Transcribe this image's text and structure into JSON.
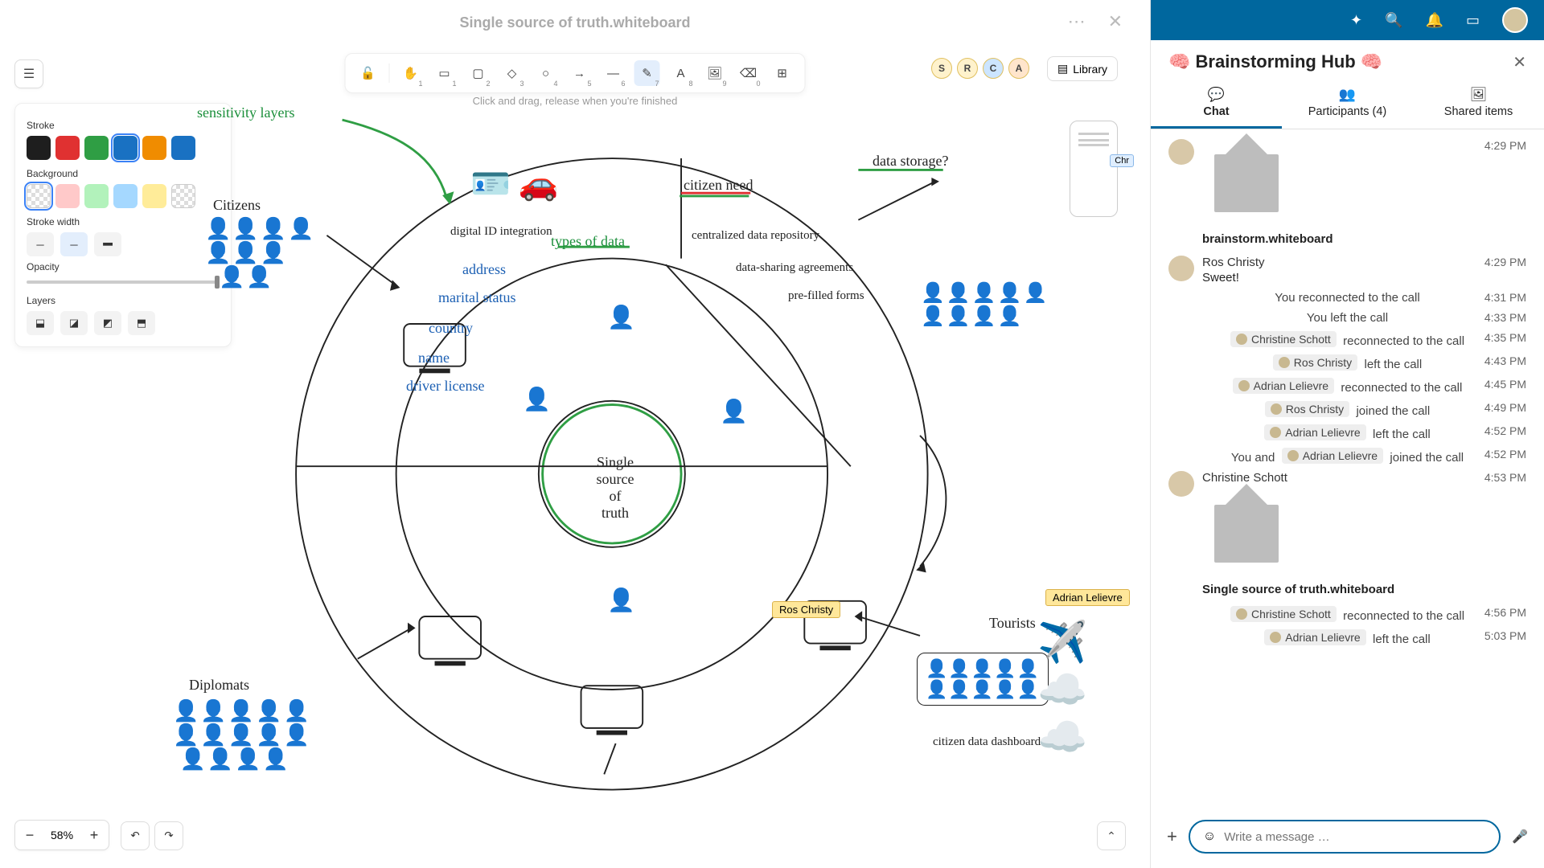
{
  "canvas": {
    "title": "Single source of truth.whiteboard",
    "hint": "Click and drag, release when you're finished",
    "zoom": "58%"
  },
  "style_panel": {
    "stroke_label": "Stroke",
    "bg_label": "Background",
    "width_label": "Stroke width",
    "opacity_label": "Opacity",
    "layers_label": "Layers",
    "stroke_colors": [
      "#1e1e1e",
      "#e03131",
      "#2f9e44",
      "#1971c2",
      "#f08c00",
      "#1971c2"
    ],
    "bg_colors": [
      "transparent",
      "#ffc9c9",
      "#b2f2bb",
      "#a5d8ff",
      "#ffec99",
      "transparent"
    ]
  },
  "toolbar": {
    "library": "Library"
  },
  "participants": [
    "S",
    "R",
    "C",
    "A"
  ],
  "drawing": {
    "center": "Single\nsource\nof\ntruth",
    "citizens": "Citizens",
    "diplomats": "Diplomats",
    "tourists": "Tourists",
    "types": "types of data",
    "address": "address",
    "marital": "marital status",
    "country": "country",
    "name": "name",
    "license": "driver license",
    "sensitivity": "sensitivity layers",
    "digital_id": "digital ID integration",
    "need": "citizen need",
    "storage": "data storage?",
    "repo": "centralized data repository",
    "sharing": "data-sharing agreements",
    "forms": "pre-filled forms",
    "dashboard": "citizen data dashboard",
    "cursor_ros": "Ros Christy",
    "cursor_adrian": "Adrian Lelievre",
    "minimap_cursor": "Chr"
  },
  "chat": {
    "title": "🧠 Brainstorming Hub 🧠",
    "tabs": {
      "chat": "Chat",
      "participants": "Participants (4)",
      "shared": "Shared items"
    },
    "input_placeholder": "Write a message …",
    "items": [
      {
        "type": "wb",
        "time": "4:29 PM",
        "name": "brainstorm.whiteboard"
      },
      {
        "type": "msg",
        "author": "Ros Christy",
        "text": "Sweet!",
        "time": "4:29 PM"
      },
      {
        "type": "sys",
        "text": "You reconnected to the call",
        "time": "4:31 PM"
      },
      {
        "type": "sys",
        "text": "You left the call",
        "time": "4:33 PM"
      },
      {
        "type": "sys_pill",
        "pill": "Christine Schott",
        "text": "reconnected to the call",
        "time": "4:35 PM"
      },
      {
        "type": "sys_pill",
        "pill": "Ros Christy",
        "text": "left the call",
        "time": "4:43 PM"
      },
      {
        "type": "sys_pill",
        "pill": "Adrian Lelievre",
        "text": "reconnected to the call",
        "time": "4:45 PM"
      },
      {
        "type": "sys_pill",
        "pill": "Ros Christy",
        "text": "joined the call",
        "time": "4:49 PM"
      },
      {
        "type": "sys_pill",
        "pill": "Adrian Lelievre",
        "text": "left the call",
        "time": "4:52 PM"
      },
      {
        "type": "sys_pill2",
        "prefix": "You and",
        "pill": "Adrian Lelievre",
        "text": "joined the call",
        "time": "4:52 PM"
      },
      {
        "type": "msg_wb",
        "author": "Christine Schott",
        "time": "4:53 PM",
        "name": "Single source of truth.whiteboard"
      },
      {
        "type": "sys_pill",
        "pill": "Christine Schott",
        "text": "reconnected to the call",
        "time": "4:56 PM"
      },
      {
        "type": "sys_pill",
        "pill": "Adrian Lelievre",
        "text": "left the call",
        "time": "5:03 PM"
      }
    ]
  }
}
